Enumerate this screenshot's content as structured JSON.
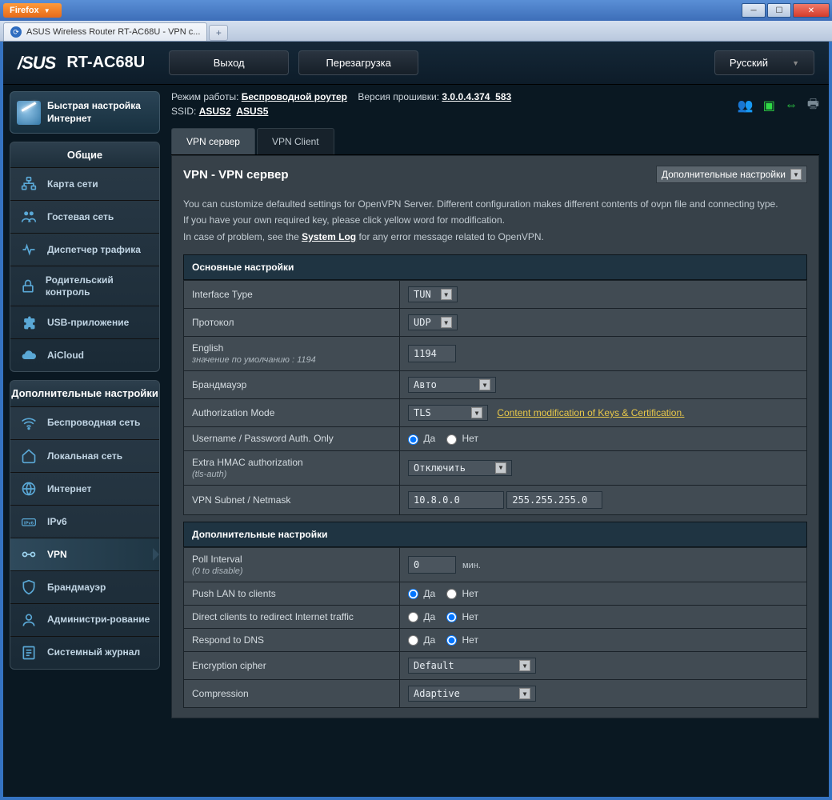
{
  "browser": {
    "firefox_label": "Firefox",
    "tab_title": "ASUS Wireless Router RT-AC68U - VPN c..."
  },
  "header": {
    "brand": "/SUS",
    "model": "RT-AC68U",
    "logout": "Выход",
    "reboot": "Перезагрузка",
    "language": "Русский"
  },
  "info": {
    "mode_label": "Режим работы:",
    "mode_value": "Беспроводной роутер",
    "fw_label": "Версия прошивки:",
    "fw_value": "3.0.0.4.374_583",
    "ssid_label": "SSID:",
    "ssid1": "ASUS2",
    "ssid5": "ASUS5"
  },
  "quick": {
    "line1": "Быстрая настройка",
    "line2": "Интернет"
  },
  "menu": {
    "general_title": "Общие",
    "general_items": [
      "Карта сети",
      "Гостевая сеть",
      "Диспетчер трафика",
      "Родительский контроль",
      "USB-приложение",
      "AiCloud"
    ],
    "advanced_title": "Дополнительные настройки",
    "advanced_items": [
      "Беспроводная сеть",
      "Локальная сеть",
      "Интернет",
      "IPv6",
      "VPN",
      "Брандмауэр",
      "Администри-рование",
      "Системный журнал"
    ]
  },
  "subtabs": {
    "server": "VPN сервер",
    "client": "VPN Client"
  },
  "page": {
    "title": "VPN - VPN сервер",
    "adv_dropdown": "Дополнительные настройки",
    "desc1": "You can customize defaulted settings for OpenVPN Server. Different configuration makes different contents of ovpn file and connecting type.",
    "desc2": "If you have your own required key, please click yellow word for modification.",
    "desc3a": "In case of problem, see the ",
    "desc3_link": "System Log",
    "desc3b": " for any error message related to OpenVPN."
  },
  "sections": {
    "basic": "Основные настройки",
    "advanced": "Дополнительные настройки"
  },
  "fields": {
    "iface_type": {
      "label": "Interface Type",
      "value": "TUN"
    },
    "protocol": {
      "label": "Протокол",
      "value": "UDP"
    },
    "port": {
      "label": "English",
      "hint": "значение по умолчанию : 1194",
      "value": "1194"
    },
    "firewall": {
      "label": "Брандмауэр",
      "value": "Авто"
    },
    "auth_mode": {
      "label": "Authorization Mode",
      "value": "TLS",
      "link": "Content modification of Keys & Certification."
    },
    "userpass": {
      "label": "Username / Password Auth. Only",
      "yes": "Да",
      "no": "Нет"
    },
    "hmac": {
      "label1": "Extra HMAC authorization",
      "label2": "(tls-auth)",
      "value": "Отключить"
    },
    "subnet": {
      "label": "VPN Subnet / Netmask",
      "ip": "10.8.0.0",
      "mask": "255.255.255.0"
    },
    "poll": {
      "label1": "Poll Interval",
      "label2": "(0 to disable)",
      "value": "0",
      "unit": "мин."
    },
    "push_lan": {
      "label": "Push LAN to clients",
      "yes": "Да",
      "no": "Нет"
    },
    "redirect": {
      "label": "Direct clients to redirect Internet traffic",
      "yes": "Да",
      "no": "Нет"
    },
    "dns": {
      "label": "Respond to DNS",
      "yes": "Да",
      "no": "Нет"
    },
    "cipher": {
      "label": "Encryption cipher",
      "value": "Default"
    },
    "compression": {
      "label": "Compression",
      "value": "Adaptive"
    }
  }
}
